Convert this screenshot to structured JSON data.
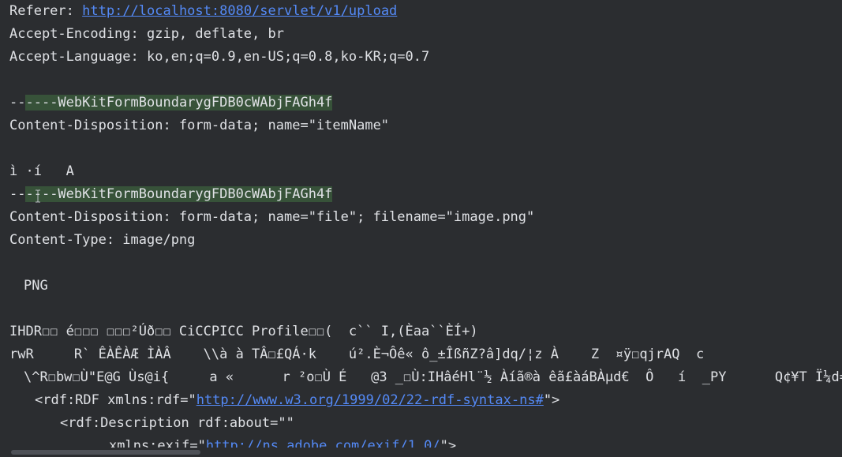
{
  "request_headers": {
    "referer_key": "Referer: ",
    "referer_url": "http://localhost:8080/servlet/v1/upload",
    "accept_encoding": "Accept-Encoding: gzip, deflate, br",
    "accept_language": "Accept-Language: ko,en;q=0.9,en-US;q=0.8,ko-KR;q=0.7"
  },
  "boundary": {
    "prefix": "--",
    "token": "----WebKitFormBoundarygFDB0cWAbjFAGh4f"
  },
  "part_item_name": {
    "disposition": "Content-Disposition: form-data; name=\"itemName\"",
    "value": "ì ·í   A"
  },
  "part_file": {
    "disposition": "Content-Disposition: form-data; name=\"file\"; filename=\"image.png\"",
    "content_type": "Content-Type: image/png"
  },
  "binary_preview": {
    "png_signature": "PNG",
    "line1": "IHDR☐☐ é☐☐☐ ☐☐☐²Úð☐☐ CiCCPICC Profile☐☐(  c`` I,(Èaa``ÈÍ+)",
    "line2": "rwR     R` ÊÀÊÀÆ ÌÀÂ    \\\\à à TÂ☐£QÁ·k    ú².È¬Ôê« ô_±ÎßñZ?â]dq/¦z À    Z  ¤ÿ☐qjrAQ  c",
    "line3": "\\^R☐bw☐Ù\"E@G Ùs@i{     a «      r ²o☐Ù É   @3 _☐Ù:IHâéHl¨½ Àíã®à êã£àáBÀµd€  Ô   í  _PY      Q¢¥T Ï¼d=##C"
  },
  "xmp": {
    "rdf_open_prefix": "<rdf:RDF xmlns:rdf=\"",
    "rdf_ns_url": "http://www.w3.org/1999/02/22-rdf-syntax-ns#",
    "rdf_open_suffix": "\">",
    "description_open": "<rdf:Description rdf:about=\"\"",
    "exif_prefix": "xmlns:exif=\"",
    "exif_url": "http://ns.adobe.com/exif/1.0/",
    "exif_suffix": "\">"
  },
  "colors": {
    "background": "#2b2d30",
    "text": "#dfe1e5",
    "link": "#548af7",
    "boundary_highlight": "#375239"
  },
  "icons": {
    "text_cursor": "i-beam-cursor-icon"
  }
}
